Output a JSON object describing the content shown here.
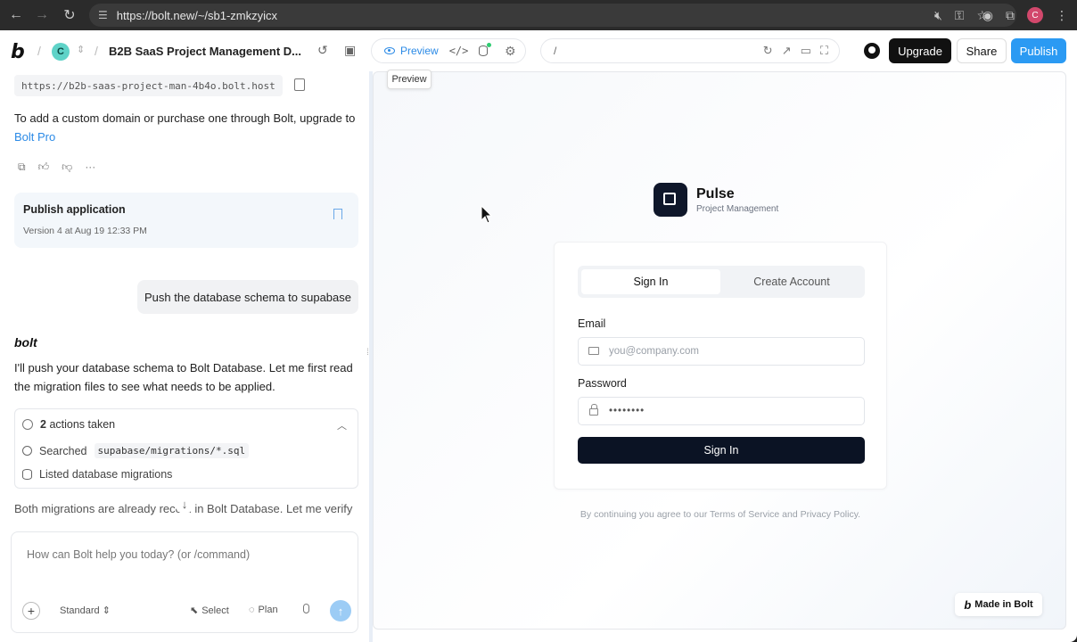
{
  "browser": {
    "url": "https://bolt.new/~/sb1-zmkzyicx",
    "profile_initial": "C"
  },
  "header": {
    "project_initial": "C",
    "project_title": "B2B SaaS Project Management D...",
    "preview_label": "Preview",
    "preview_tooltip": "Preview",
    "path": "/",
    "upgrade_label": "Upgrade",
    "share_label": "Share",
    "publish_label": "Publish"
  },
  "chat": {
    "site_url": "https://b2b-saas-project-man-4b4o.bolt.host",
    "custom_domain_text": "To add a custom domain or purchase one through Bolt, upgrade to",
    "bolt_pro_link": "Bolt Pro",
    "publish_card": {
      "title": "Publish application",
      "subtitle": "Version 4 at Aug 19 12:33 PM"
    },
    "user_message": "Push the database schema to supabase",
    "assistant_name": "bolt",
    "assistant_message": "I'll push your database schema to Bolt Database. Let me first read the migration files to see what needs to be applied.",
    "actions": {
      "count": "2",
      "label": "actions taken",
      "items": [
        {
          "verb": "Searched",
          "detail": "supabase/migrations/*.sql"
        },
        {
          "verb": "Listed database migrations",
          "detail": ""
        }
      ]
    },
    "faded_message": "Both migrations are already reco    d in Bolt Database. Let me verify",
    "composer": {
      "placeholder": "How can Bolt help you today? (or /command)",
      "mode": "Standard",
      "select_label": "Select",
      "plan_label": "Plan"
    }
  },
  "preview": {
    "brand_name": "Pulse",
    "brand_sub": "Project Management",
    "tabs": [
      "Sign In",
      "Create Account"
    ],
    "email_label": "Email",
    "email_placeholder": "you@company.com",
    "password_label": "Password",
    "password_value": "••••••••",
    "signin_button": "Sign In",
    "terms": "By continuing you agree to our Terms of Service and Privacy Policy.",
    "made_in": "Made in Bolt"
  },
  "colors": {
    "accent": "#2b9af3",
    "primary_dark": "#0b1324"
  }
}
